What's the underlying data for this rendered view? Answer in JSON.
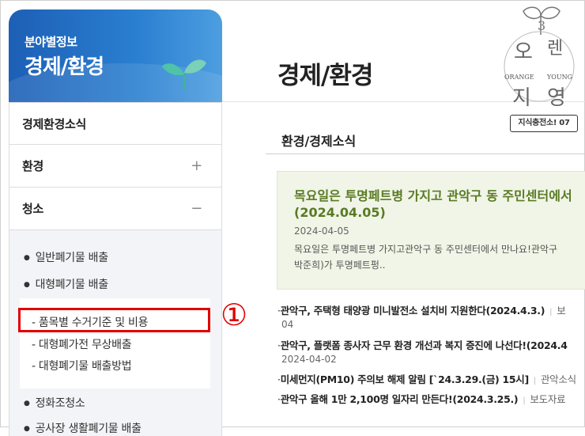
{
  "sidebar": {
    "subtitle": "분야별정보",
    "title": "경제/환경",
    "menu": [
      {
        "label": "경제환경소식",
        "toggle": ""
      },
      {
        "label": "환경",
        "toggle": "+"
      },
      {
        "label": "청소",
        "toggle": "−"
      }
    ],
    "submenu": {
      "level2": [
        "일반폐기물 배출",
        "대형폐기물 배출",
        "정화조청소",
        "공사장 생활폐기물 배출"
      ],
      "level3": [
        "- 품목별 수거기준 및 비용",
        "- 대형폐가전 무상배출",
        "- 대형폐기물 배출방법"
      ]
    }
  },
  "annotation": {
    "number": "①"
  },
  "main": {
    "page_title": "경제/환경",
    "section_title": "환경/경제소식",
    "feature": {
      "title_line1": "목요일은 투명페트병 가지고 관악구 동 주민센터에서",
      "title_line2": "(2024.04.05)",
      "date": "2024-04-05",
      "text_line1": "목요일은 투명페트병 가지고관악구 동 주민센터에서 만나요!관악구",
      "text_line2": "박준희)가 투명페트펑.."
    },
    "news": [
      {
        "title": "관악구, 주택형 태양광 미니발전소 설치비 지원한다(2024.4.3.)",
        "category": "보",
        "date": "04"
      },
      {
        "title": "관악구, 플랫폼 종사자 근무 환경 개선과 복지 증진에 나선다!(2024.4",
        "category": "",
        "date": "2024-04-02"
      },
      {
        "title": "미세먼지(PM10) 주의보 해제 알림 [`24.3.29.(금) 15시]",
        "category": "관악소식",
        "date": ""
      },
      {
        "title": "관악구 올해 1만 2,100명 일자리 만든다!(2024.3.25.)",
        "category": "보도자료",
        "date": ""
      }
    ]
  },
  "logo": {
    "char_top": "3",
    "char1": "오",
    "char2": "렌",
    "char3": "지",
    "char4": "영",
    "ring_left": "ORANGE",
    "ring_right": "YOUNG",
    "badge": "지식충전소! 07"
  }
}
